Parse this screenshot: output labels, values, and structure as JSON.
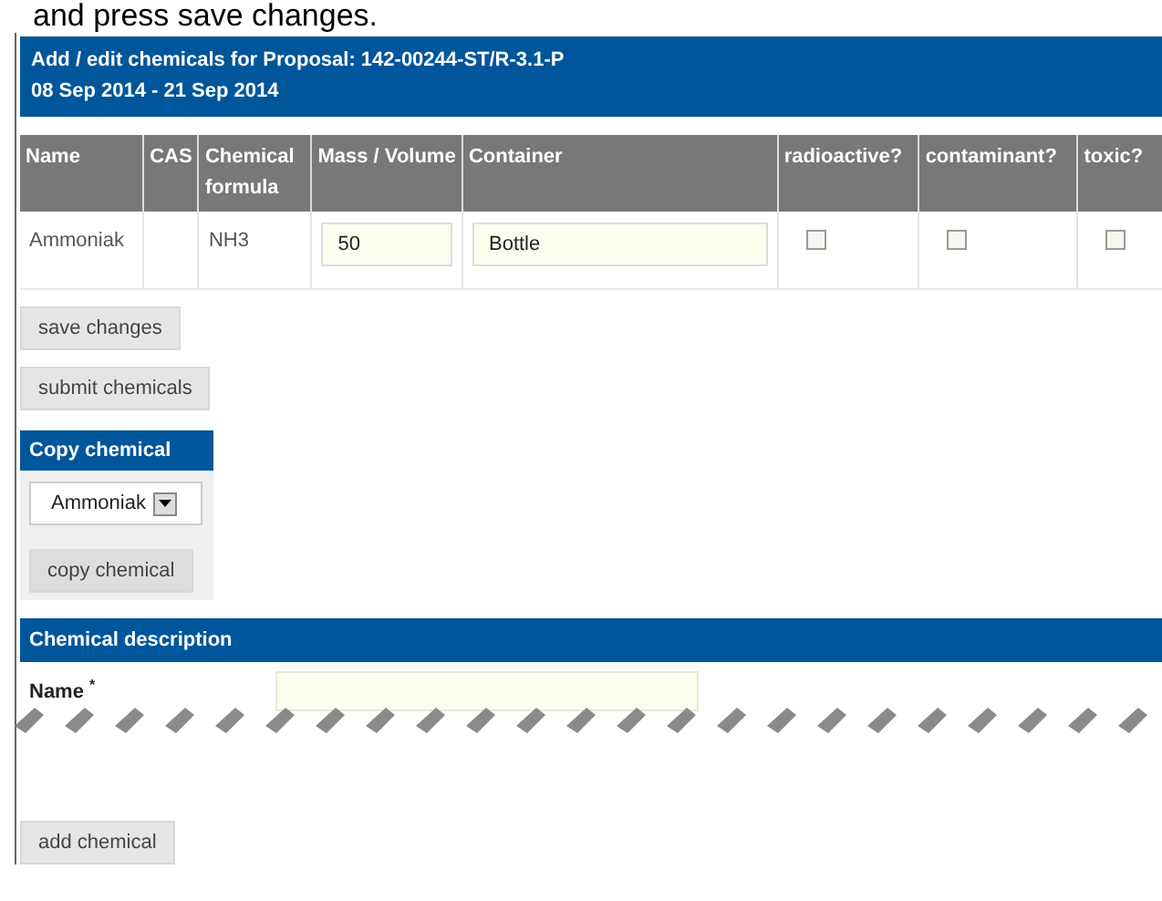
{
  "intro_text": "and press save changes.",
  "header": {
    "title": "Add / edit chemicals for Proposal: 142-00244-ST/R-3.1-P",
    "dates": "08 Sep 2014 - 21 Sep 2014"
  },
  "table": {
    "columns": [
      {
        "label": "Name",
        "kind": "text"
      },
      {
        "label": "CAS",
        "kind": "text"
      },
      {
        "label": "Chemical formula",
        "kind": "text"
      },
      {
        "label": "Mass / Volume",
        "kind": "input"
      },
      {
        "label": "Container",
        "kind": "input"
      },
      {
        "label": "radioactive?",
        "kind": "check"
      },
      {
        "label": "contaminant?",
        "kind": "check"
      },
      {
        "label": "toxic?",
        "kind": "check"
      }
    ],
    "rows": [
      {
        "cells": [
          {
            "text": "Ammoniak"
          },
          {
            "text": ""
          },
          {
            "text": "NH3"
          },
          {
            "value": "50"
          },
          {
            "value": "Bottle"
          },
          {
            "checked": false
          },
          {
            "checked": false
          },
          {
            "checked": false
          }
        ]
      }
    ]
  },
  "buttons": [
    "save changes",
    "submit chemicals"
  ],
  "copy_panel": {
    "title": "Copy chemical",
    "select_value": "Ammoniak",
    "button": "copy chemical"
  },
  "description": {
    "title": "Chemical description",
    "field_label": "Name",
    "required_mark": "*"
  },
  "bottom_button": "add chemical"
}
